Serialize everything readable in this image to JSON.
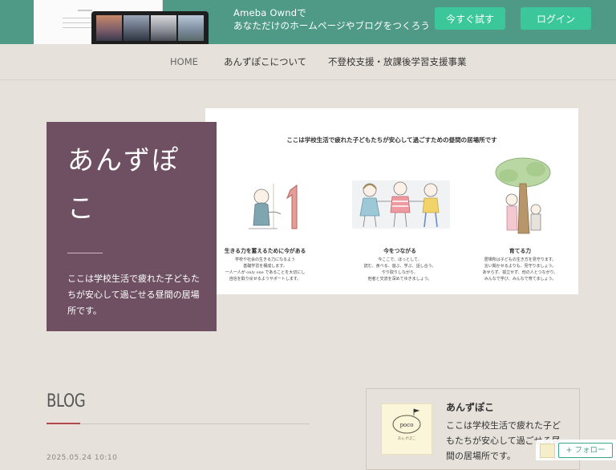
{
  "promo": {
    "line1": "Ameba Owndで",
    "line2": "あなただけのホームページやブログをつくろう",
    "try_label": "今すぐ試す",
    "login_label": "ログイン",
    "accent_color": "#3cc79a",
    "banner_color": "#4f9a86"
  },
  "nav": {
    "items": [
      {
        "label": "HOME"
      },
      {
        "label": "あんずぽこについて"
      },
      {
        "label": "不登校支援・放課後学習支援事業"
      }
    ]
  },
  "hero": {
    "title": "あんずぽこ",
    "description": "ここは学校生活で疲れた子どもたちが安心して過ごせる昼間の居場所です。",
    "box_color": "#6e5062",
    "illustration": {
      "title": "ここは学校生活で疲れた子どもたちが安心して過ごすための昼間の居場所です",
      "columns": [
        {
          "heading": "生きる力を蓄えるために今がある",
          "body": [
            "学校や社会の生きる力になるよう",
            "基礎学習を構成します。",
            "一人一人が only one であることを大切にし",
            "自信を取り戻せるようサポートします。"
          ]
        },
        {
          "heading": "今をつながる",
          "body": [
            "今ここで、ほっとして、",
            "読む、食べる、遊ぶ、学ぶ、話し合う。",
            "やり取りしながら、",
            "他者と交流を深めてゆきましょう。"
          ]
        },
        {
          "heading": "育てる力",
          "body": [
            "居場所は子どもの生き方を見守ります。",
            "言い聞かせるよりも、見守りましょう。",
            "あせらず、孤立せず、他の人とつながり、",
            "みんなで学び、みんなで育てましょう。"
          ]
        }
      ]
    }
  },
  "blog": {
    "heading": "BLOG",
    "date": "2025.05.24 10:10",
    "accent_color": "#b5484d"
  },
  "profile": {
    "name": "あんずぽこ",
    "description": "ここは学校生活で疲れた子どもたちが安心して過ごせる昼間の居場所です。",
    "logo_text": "poco",
    "logo_subtext": "あんずぽこ"
  },
  "follow": {
    "label": "+ フォロー"
  },
  "icons": {
    "follow_plus": "plus-icon",
    "logo": "anzupoco-logo-icon"
  }
}
